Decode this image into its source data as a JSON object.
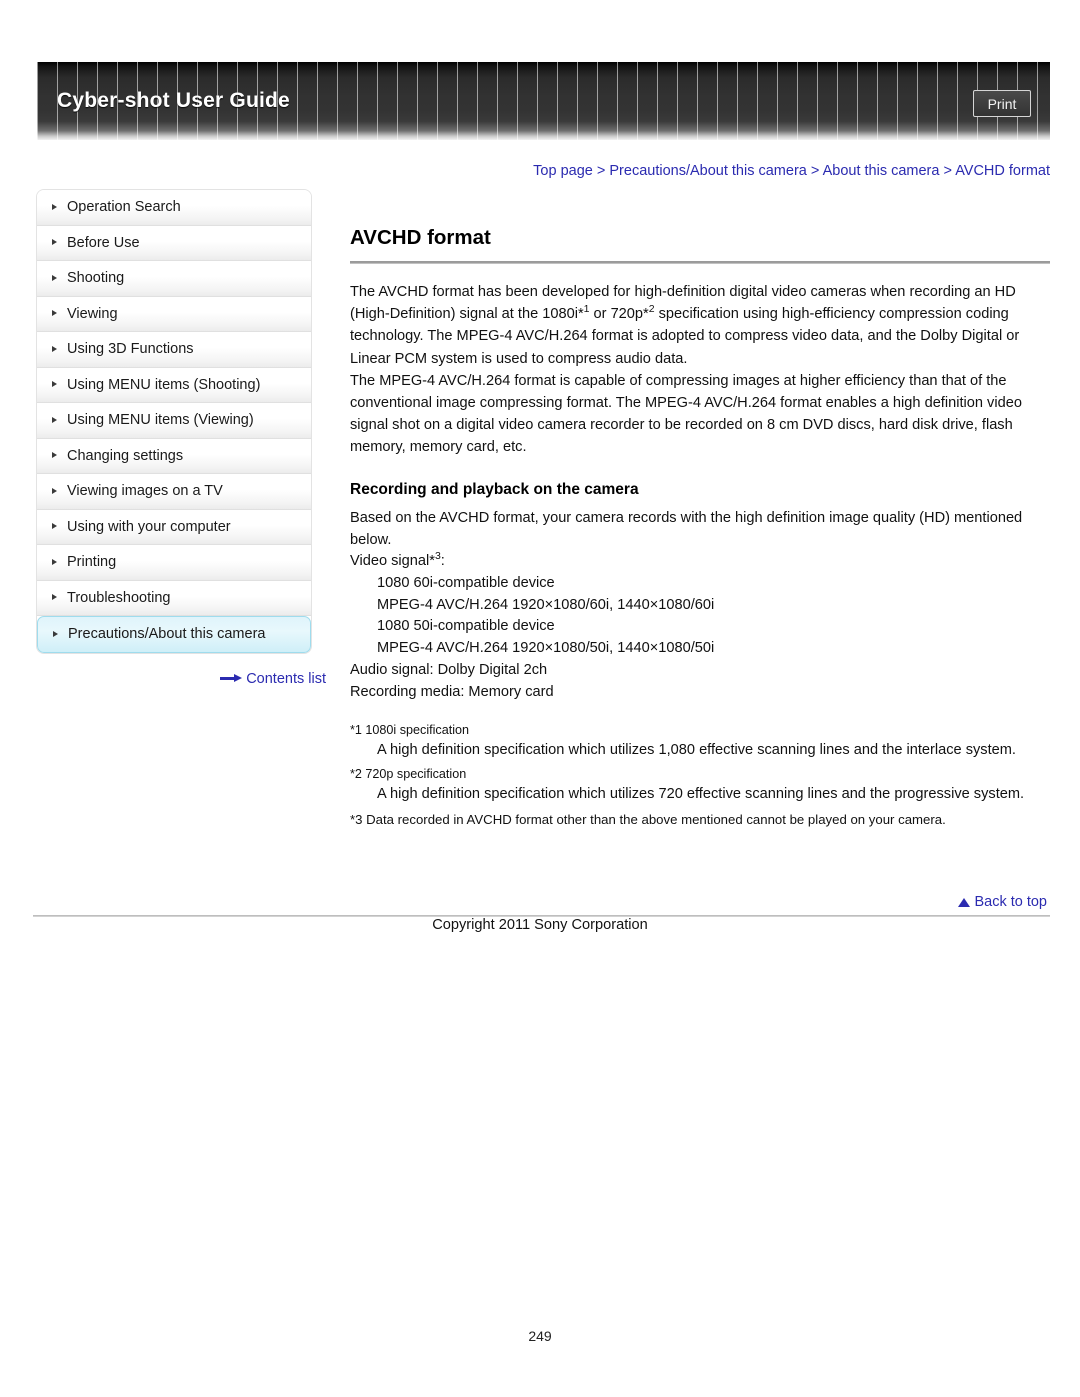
{
  "header": {
    "title": "Cyber-shot User Guide",
    "print_label": "Print"
  },
  "breadcrumb": {
    "items": [
      "Top page",
      "Precautions/About this camera",
      "About this camera",
      "AVCHD format"
    ],
    "separator": ">",
    "full": "Top page > Precautions/About this camera > About this camera > AVCHD format"
  },
  "sidebar": {
    "items": [
      {
        "label": "Operation Search",
        "active": false
      },
      {
        "label": "Before Use",
        "active": false
      },
      {
        "label": "Shooting",
        "active": false
      },
      {
        "label": "Viewing",
        "active": false
      },
      {
        "label": "Using 3D Functions",
        "active": false
      },
      {
        "label": "Using MENU items (Shooting)",
        "active": false
      },
      {
        "label": "Using MENU items (Viewing)",
        "active": false
      },
      {
        "label": "Changing settings",
        "active": false
      },
      {
        "label": "Viewing images on a TV",
        "active": false
      },
      {
        "label": "Using with your computer",
        "active": false
      },
      {
        "label": "Printing",
        "active": false
      },
      {
        "label": "Troubleshooting",
        "active": false
      },
      {
        "label": "Precautions/About this camera",
        "active": true
      }
    ],
    "contents_list_label": "Contents list"
  },
  "main": {
    "title": "AVCHD format",
    "paragraph_1_a": "The AVCHD format has been developed for high-definition digital video cameras when recording an HD (High-Definition) signal at the 1080i*",
    "paragraph_1_sup1": "1",
    "paragraph_1_b": " or 720p*",
    "paragraph_1_sup2": "2",
    "paragraph_1_c": " specification using high-efficiency compression coding technology. The MPEG-4 AVC/H.264 format is adopted to compress video data, and the Dolby Digital or Linear PCM system is used to compress audio data.",
    "paragraph_2": "The MPEG-4 AVC/H.264 format is capable of compressing images at higher efficiency than that of the conventional image compressing format. The MPEG-4 AVC/H.264 format enables a high definition video signal shot on a digital video camera recorder to be recorded on 8 cm DVD discs, hard disk drive, flash memory, memory card, etc.",
    "sub_heading": "Recording and playback on the camera",
    "paragraph_3": "Based on the AVCHD format, your camera records with the high definition image quality (HD) mentioned below.",
    "video_signal_label_a": "Video signal*",
    "video_signal_sup": "3",
    "video_signal_label_b": ":",
    "spec_lines": [
      "1080 60i-compatible device",
      "MPEG-4 AVC/H.264 1920×1080/60i, 1440×1080/60i",
      "1080 50i-compatible device",
      "MPEG-4 AVC/H.264 1920×1080/50i, 1440×1080/50i"
    ],
    "audio_signal": "Audio signal: Dolby Digital 2ch",
    "recording_media": "Recording media: Memory card",
    "notes": [
      {
        "label": "*1 1080i specification",
        "body": "A high definition specification which utilizes 1,080 effective scanning lines and the interlace system."
      },
      {
        "label": "*2 720p specification",
        "body": "A high definition specification which utilizes 720 effective scanning lines and the progressive system."
      }
    ],
    "note_3": "*3 Data recorded in AVCHD format other than the above mentioned cannot be played on your camera."
  },
  "footer": {
    "back_to_top": "Back to top",
    "copyright": "Copyright 2011 Sony Corporation",
    "page_number": "249"
  },
  "colors": {
    "link": "#2b2bb0",
    "active_item_bg": "#dff4fb",
    "banner_dark": "#2b2b2b"
  }
}
